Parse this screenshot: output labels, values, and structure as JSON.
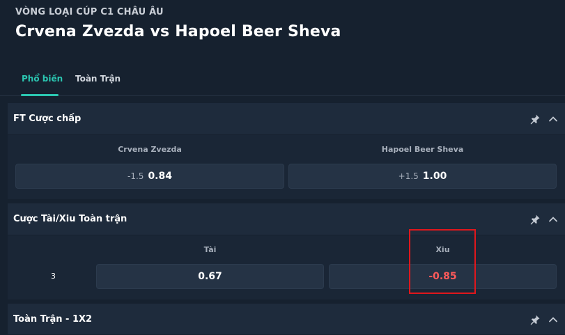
{
  "header": {
    "league": "VÒNG LOẠI CÚP C1 CHÂU ÂU",
    "match_title": "Crvena Zvezda vs Hapoel Beer Sheva"
  },
  "tabs": [
    {
      "label": "Phổ biến",
      "active": true
    },
    {
      "label": "Toàn Trận",
      "active": false
    }
  ],
  "handicap_market": {
    "title": "FT Cược chấp",
    "home_team": "Crvena Zvezda",
    "away_team": "Hapoel Beer Sheva",
    "home_line": "-1.5",
    "home_odds": "0.84",
    "away_line": "+1.5",
    "away_odds": "1.00"
  },
  "over_under_market": {
    "title": "Cược Tài/Xiu Toàn trận",
    "over_label": "Tài",
    "under_label": "Xiu",
    "line": "3",
    "over_odds": "0.67",
    "under_odds": "-0.85"
  },
  "one_x_two_market": {
    "title": "Toàn Trận - 1X2"
  },
  "icons": {
    "pin": "pin-icon",
    "collapse": "chevron-up-icon"
  },
  "colors": {
    "accent": "#2bc6b1",
    "negative_odds": "#ff5a5a",
    "highlight_box": "#e0171c"
  }
}
